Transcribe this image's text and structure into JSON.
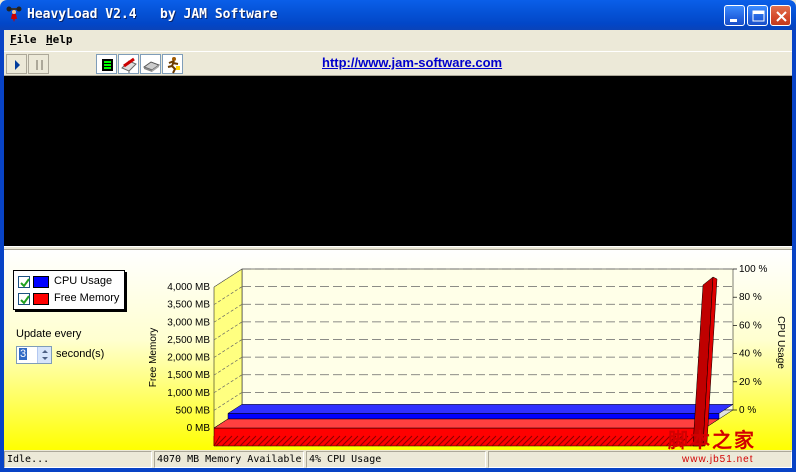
{
  "window": {
    "title": "HeavyLoad V2.4   by JAM Software",
    "icon": "heavyload-figure-icon",
    "controls": [
      "minimize-icon",
      "maximize-icon",
      "close-icon"
    ]
  },
  "menu": {
    "file": {
      "hotkey": "F",
      "rest": "ile"
    },
    "help": {
      "hotkey": "H",
      "rest": "elp"
    }
  },
  "toolbar": {
    "buttons": [
      "play-icon",
      "pause-icon",
      "cpu-load-icon",
      "disk-write-icon",
      "memory-icon",
      "runner-icon"
    ],
    "link": "http://www.jam-software.com"
  },
  "settings": {
    "legend": [
      {
        "label": "CPU Usage",
        "checked": true,
        "color": "#0000ff"
      },
      {
        "label": "Free Memory",
        "checked": true,
        "color": "#ff0000"
      }
    ],
    "update_label": "Update every",
    "update_value": "3",
    "seconds_label": "second(s)"
  },
  "chart_data": {
    "type": "area",
    "left_axis": {
      "label": "Free Memory",
      "ticks": [
        "0 MB",
        "500 MB",
        "1,000 MB",
        "1,500 MB",
        "2,000 MB",
        "2,500 MB",
        "3,000 MB",
        "3,500 MB",
        "4,000 MB"
      ],
      "range": [
        0,
        4000
      ]
    },
    "right_axis": {
      "label": "CPU Usage",
      "ticks": [
        "0 %",
        "20 %",
        "40 %",
        "60 %",
        "80 %",
        "100 %"
      ],
      "range": [
        0,
        100
      ]
    },
    "grid": true,
    "series": [
      {
        "name": "Free Memory",
        "color": "#ff0000",
        "values": [
          4070,
          4070,
          4070,
          4070,
          4070,
          4070,
          4070,
          4070,
          4070,
          4070,
          4070,
          4070,
          4070,
          4070,
          4070,
          4070,
          4070,
          4070,
          4070,
          4070,
          4070,
          4070,
          4070,
          4070,
          4070,
          4070,
          4070,
          4070,
          4070,
          4070,
          4070,
          4070,
          4070,
          4070,
          4070,
          4070,
          4070,
          4070,
          4070,
          4070
        ]
      },
      {
        "name": "CPU Usage",
        "color": "#0000ff",
        "values": [
          4,
          4,
          4,
          4,
          4,
          4,
          4,
          4,
          4,
          4,
          4,
          4,
          4,
          4,
          4,
          4,
          4,
          4,
          4,
          4,
          4,
          4,
          4,
          4,
          4,
          4,
          4,
          4,
          4,
          4,
          4,
          4,
          4,
          4,
          4,
          4,
          4,
          4,
          4,
          4
        ]
      }
    ]
  },
  "status": {
    "state": "Idle...",
    "memory": "4070 MB Memory Available",
    "cpu": "4% CPU Usage"
  },
  "watermark": {
    "text": "脚本之家",
    "url": "www.jb51.net"
  }
}
